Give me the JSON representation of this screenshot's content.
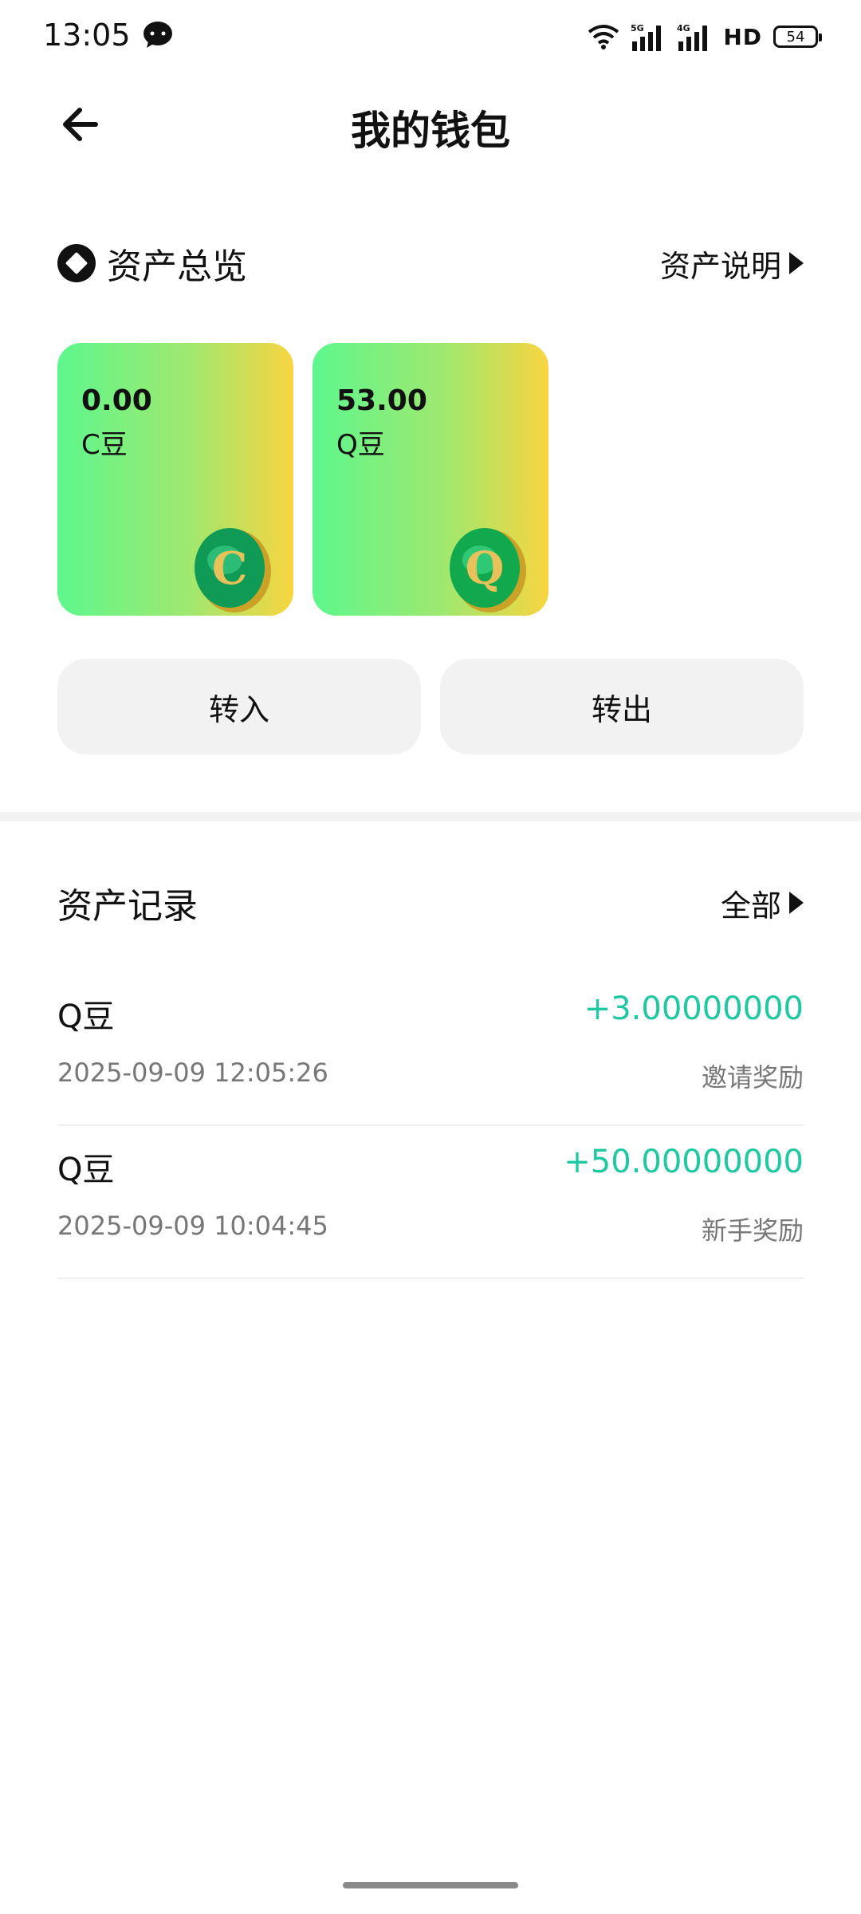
{
  "status_bar": {
    "time": "13:05",
    "signal1_tag": "5G",
    "signal2_tag": "4G",
    "hd_label": "HD",
    "battery": "54"
  },
  "header": {
    "title": "我的钱包",
    "back_icon": "arrow-left-icon"
  },
  "overview": {
    "title": "资产总览",
    "link_label": "资产说明",
    "cards": [
      {
        "value": "0.00",
        "label": "C豆",
        "coin_letter": "C"
      },
      {
        "value": "53.00",
        "label": "Q豆",
        "coin_letter": "Q"
      }
    ],
    "transfer_in_label": "转入",
    "transfer_out_label": "转出"
  },
  "records": {
    "title": "资产记录",
    "filter_label": "全部",
    "items": [
      {
        "name": "Q豆",
        "amount": "+3.00000000",
        "time": "2025-09-09 12:05:26",
        "type": "邀请奖励"
      },
      {
        "name": "Q豆",
        "amount": "+50.00000000",
        "time": "2025-09-09 10:04:45",
        "type": "新手奖励"
      }
    ]
  },
  "colors": {
    "accent_green": "#1fc8a0",
    "card_gradient_start": "#5ef78d",
    "card_gradient_end": "#f8d540",
    "button_bg": "#f2f2f2"
  }
}
